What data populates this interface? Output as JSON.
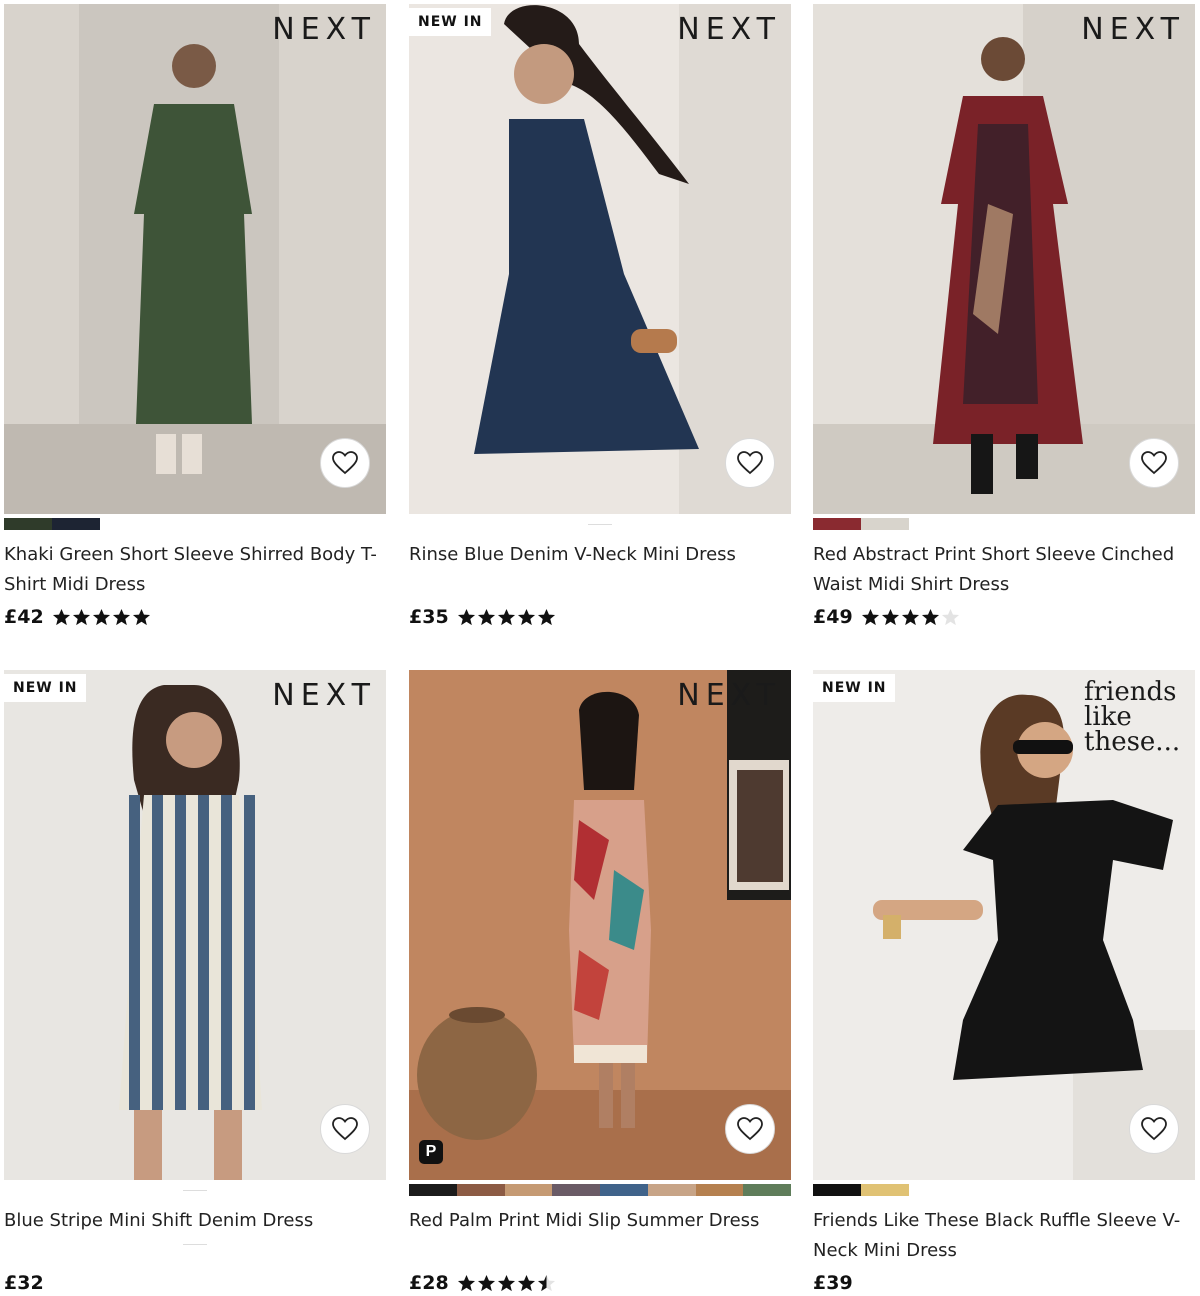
{
  "products": [
    {
      "title": "Khaki Green Short Sleeve Shirred Body T-Shirt Midi Dress",
      "price": "£42",
      "rating": 5,
      "brand": "NEXT",
      "badge": "",
      "swatches": [
        "#2f3b2a",
        "#1d2433"
      ],
      "bg": [
        "#d9d5cf",
        "#c7c2bb"
      ],
      "garment": "#3e5438"
    },
    {
      "title": "Rinse Blue Denim V-Neck Mini Dress",
      "price": "£35",
      "rating": 5,
      "brand": "NEXT",
      "badge": "NEW IN",
      "swatches": [],
      "bg": [
        "#ece7e2",
        "#dedad5"
      ],
      "garment": "#223552"
    },
    {
      "title": "Red Abstract Print Short Sleeve Cinched Waist Midi Shirt Dress",
      "price": "£49",
      "rating": 4,
      "brand": "NEXT",
      "badge": "",
      "swatches": [
        "#8a2a30",
        "#d8d4cc"
      ],
      "bg": [
        "#e6e2dc",
        "#d4cfc8"
      ],
      "garment": "#7a2228"
    },
    {
      "title": "Blue Stripe Mini Shift Denim Dress",
      "price": "£32",
      "rating": 0,
      "brand": "NEXT",
      "badge": "NEW IN",
      "swatches": [],
      "bg": [
        "#e9e7e3",
        "#d9d6d1"
      ],
      "garment": "#46617f"
    },
    {
      "title": "Red Palm Print Midi Slip Summer Dress",
      "price": "£28",
      "rating": 4.5,
      "brand": "NEXT",
      "badge": "",
      "swatches": [
        "#1b1b1b",
        "#8c5b44",
        "#c59a73",
        "#6a5b66",
        "#40638a",
        "#c7a487",
        "#b5804f",
        "#5f7d5a"
      ],
      "bg": [
        "#c48a63",
        "#b07650"
      ],
      "garment": "#d7a08a"
    },
    {
      "title": "Friends Like These Black Ruffle Sleeve V-Neck Mini Dress",
      "price": "£39",
      "rating": 0,
      "brand": "friends like these...",
      "badge": "NEW IN",
      "swatches": [
        "#111111",
        "#e0c274"
      ],
      "bg": [
        "#efedea",
        "#e2e0dc"
      ],
      "garment": "#141414"
    }
  ]
}
